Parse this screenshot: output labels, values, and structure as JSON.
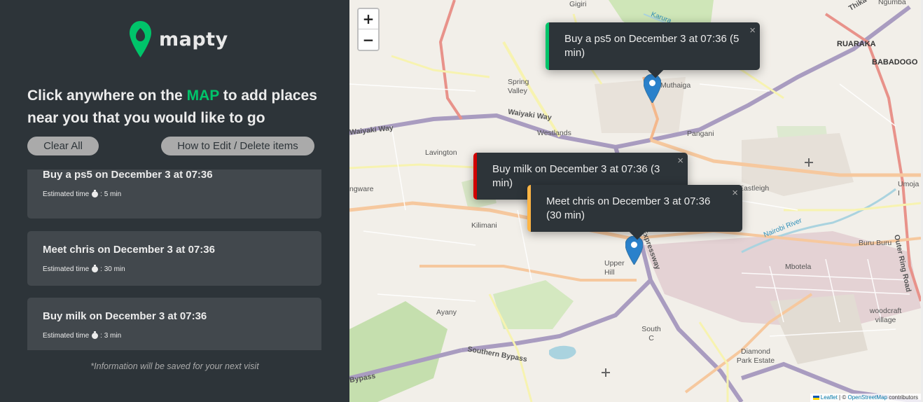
{
  "sidebar": {
    "logo_text": "mapty",
    "intro_before": "Click anywhere on the ",
    "intro_accent": "MAP",
    "intro_after": " to add places near you that you would like to go",
    "clear_button": "Clear All",
    "help_button": "How to Edit / Delete items",
    "workouts": [
      {
        "title": "Buy a ps5 on December 3 at 07:36",
        "time_label": "Estimated time",
        "time_value": ": 5 min"
      },
      {
        "title": "Meet chris on December 3 at 07:36",
        "time_label": "Estimated time",
        "time_value": ": 30 min"
      },
      {
        "title": "Buy milk on December 3 at 07:36",
        "time_label": "Estimated time",
        "time_value": ": 3 min"
      }
    ],
    "footnote": "*Information will be saved for your next visit"
  },
  "map": {
    "zoom_in": "+",
    "zoom_out": "−",
    "popups": [
      {
        "text": "Buy a ps5 on December 3 at 07:36 (5 min)",
        "color": "#00c46a",
        "close": "×"
      },
      {
        "text": "Buy milk on December 3 at 07:36 (3 min)",
        "color": "#d00000",
        "close": "×"
      },
      {
        "text": "Meet chris on December 3 at 07:36 (30 min)",
        "color": "#ffb545",
        "close": "×"
      }
    ],
    "places": [
      "Gigiri",
      "Ngumba",
      "RUARAKA",
      "BABADOGO",
      "Spring Valley",
      "Muthaiga",
      "Waiyaki Way",
      "Waiyaki Way",
      "Westlands",
      "Pangani",
      "Lavington",
      "ngware",
      "Eastleigh",
      "Umoja I",
      "Kilimani",
      "Nairobi River",
      "Buru Buru",
      "Upper Hill",
      "Mbotela",
      "Outer Ring Road",
      "woodcraft village",
      "Ayany",
      "South C",
      "Southern Bypass",
      "Bypass",
      "Diamond Park Estate",
      "Thika",
      "Expressway",
      "Karura"
    ],
    "attribution_leaflet": "Leaflet",
    "attribution_sep": "| ©",
    "attribution_osm": "OpenStreetMap",
    "attribution_tail": "contributors"
  },
  "colors": {
    "sidebar_bg": "#2d3439",
    "card_bg": "#42484d",
    "brand_green": "#00c46a",
    "marker_blue": "#2a81cb"
  }
}
